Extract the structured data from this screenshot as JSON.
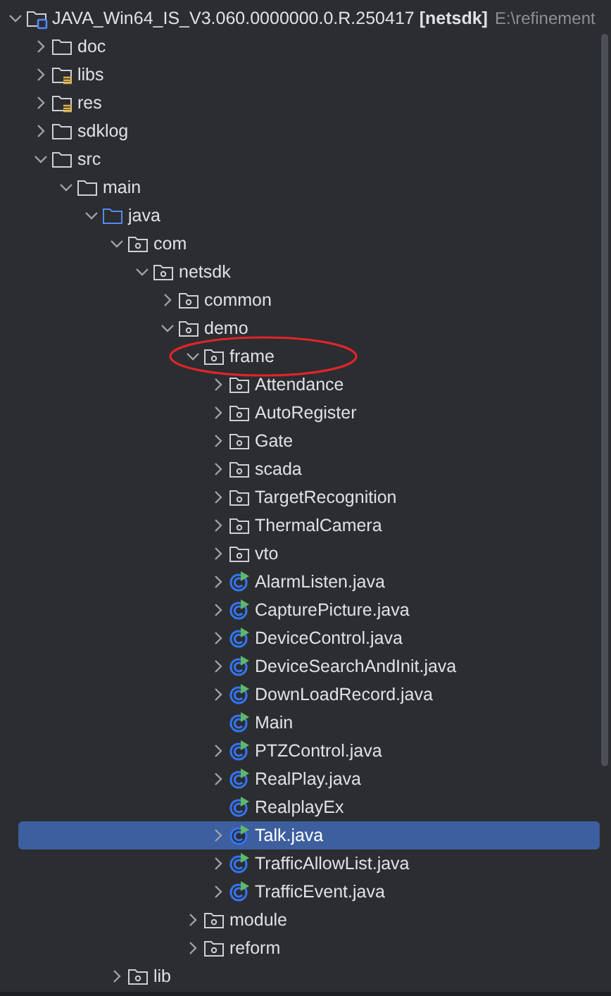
{
  "project_tree": {
    "name": "JAVA_Win64_IS_V3.060.0000000.0.R.250417 **[netsdk]**",
    "path": "E:\\refinement",
    "kind": "project",
    "expanded": true,
    "selected": false,
    "children": [
      {
        "name": "doc",
        "kind": "folder",
        "expanded": false,
        "selected": false
      },
      {
        "name": "libs",
        "kind": "resource-folder",
        "expanded": false,
        "selected": false
      },
      {
        "name": "res",
        "kind": "resource-folder",
        "expanded": false,
        "selected": false
      },
      {
        "name": "sdklog",
        "kind": "folder",
        "expanded": false,
        "selected": false
      },
      {
        "name": "src",
        "kind": "folder",
        "expanded": true,
        "selected": false,
        "children": [
          {
            "name": "main",
            "kind": "folder",
            "expanded": true,
            "selected": false,
            "children": [
              {
                "name": "java",
                "kind": "source-folder",
                "expanded": true,
                "selected": false,
                "children": [
                  {
                    "name": "com",
                    "kind": "package",
                    "expanded": true,
                    "selected": false,
                    "children": [
                      {
                        "name": "netsdk",
                        "kind": "package",
                        "expanded": true,
                        "selected": false,
                        "children": [
                          {
                            "name": "common",
                            "kind": "package",
                            "expanded": false,
                            "selected": false
                          },
                          {
                            "name": "demo",
                            "kind": "package",
                            "expanded": true,
                            "selected": false,
                            "children": [
                              {
                                "name": "frame",
                                "kind": "package",
                                "expanded": true,
                                "selected": false,
                                "circled": true,
                                "children": [
                                  {
                                    "name": "Attendance",
                                    "kind": "package",
                                    "expanded": false,
                                    "selected": false
                                  },
                                  {
                                    "name": "AutoRegister",
                                    "kind": "package",
                                    "expanded": false,
                                    "selected": false
                                  },
                                  {
                                    "name": "Gate",
                                    "kind": "package",
                                    "expanded": false,
                                    "selected": false
                                  },
                                  {
                                    "name": "scada",
                                    "kind": "package",
                                    "expanded": false,
                                    "selected": false
                                  },
                                  {
                                    "name": "TargetRecognition",
                                    "kind": "package",
                                    "expanded": false,
                                    "selected": false
                                  },
                                  {
                                    "name": "ThermalCamera",
                                    "kind": "package",
                                    "expanded": false,
                                    "selected": false
                                  },
                                  {
                                    "name": "vto",
                                    "kind": "package",
                                    "expanded": false,
                                    "selected": false
                                  },
                                  {
                                    "name": "AlarmListen.java",
                                    "kind": "class",
                                    "expanded": false,
                                    "selected": false
                                  },
                                  {
                                    "name": "CapturePicture.java",
                                    "kind": "class",
                                    "expanded": false,
                                    "selected": false
                                  },
                                  {
                                    "name": "DeviceControl.java",
                                    "kind": "class",
                                    "expanded": false,
                                    "selected": false
                                  },
                                  {
                                    "name": "DeviceSearchAndInit.java",
                                    "kind": "class",
                                    "expanded": false,
                                    "selected": false
                                  },
                                  {
                                    "name": "DownLoadRecord.java",
                                    "kind": "class",
                                    "expanded": false,
                                    "selected": false
                                  },
                                  {
                                    "name": "Main",
                                    "kind": "class",
                                    "selected": false
                                  },
                                  {
                                    "name": "PTZControl.java",
                                    "kind": "class",
                                    "expanded": false,
                                    "selected": false
                                  },
                                  {
                                    "name": "RealPlay.java",
                                    "kind": "class",
                                    "expanded": false,
                                    "selected": false
                                  },
                                  {
                                    "name": "RealplayEx",
                                    "kind": "class",
                                    "selected": false
                                  },
                                  {
                                    "name": "Talk.java",
                                    "kind": "class",
                                    "expanded": false,
                                    "selected": true
                                  },
                                  {
                                    "name": "TrafficAllowList.java",
                                    "kind": "class",
                                    "expanded": false,
                                    "selected": false
                                  },
                                  {
                                    "name": "TrafficEvent.java",
                                    "kind": "class",
                                    "expanded": false,
                                    "selected": false
                                  }
                                ]
                              },
                              {
                                "name": "module",
                                "kind": "package",
                                "expanded": false,
                                "selected": false
                              },
                              {
                                "name": "reform",
                                "kind": "package",
                                "expanded": false,
                                "selected": false
                              }
                            ]
                          }
                        ]
                      }
                    ]
                  },
                  {
                    "name": "lib",
                    "kind": "package",
                    "expanded": false,
                    "selected": false
                  }
                ]
              }
            ]
          }
        ]
      }
    ]
  }
}
